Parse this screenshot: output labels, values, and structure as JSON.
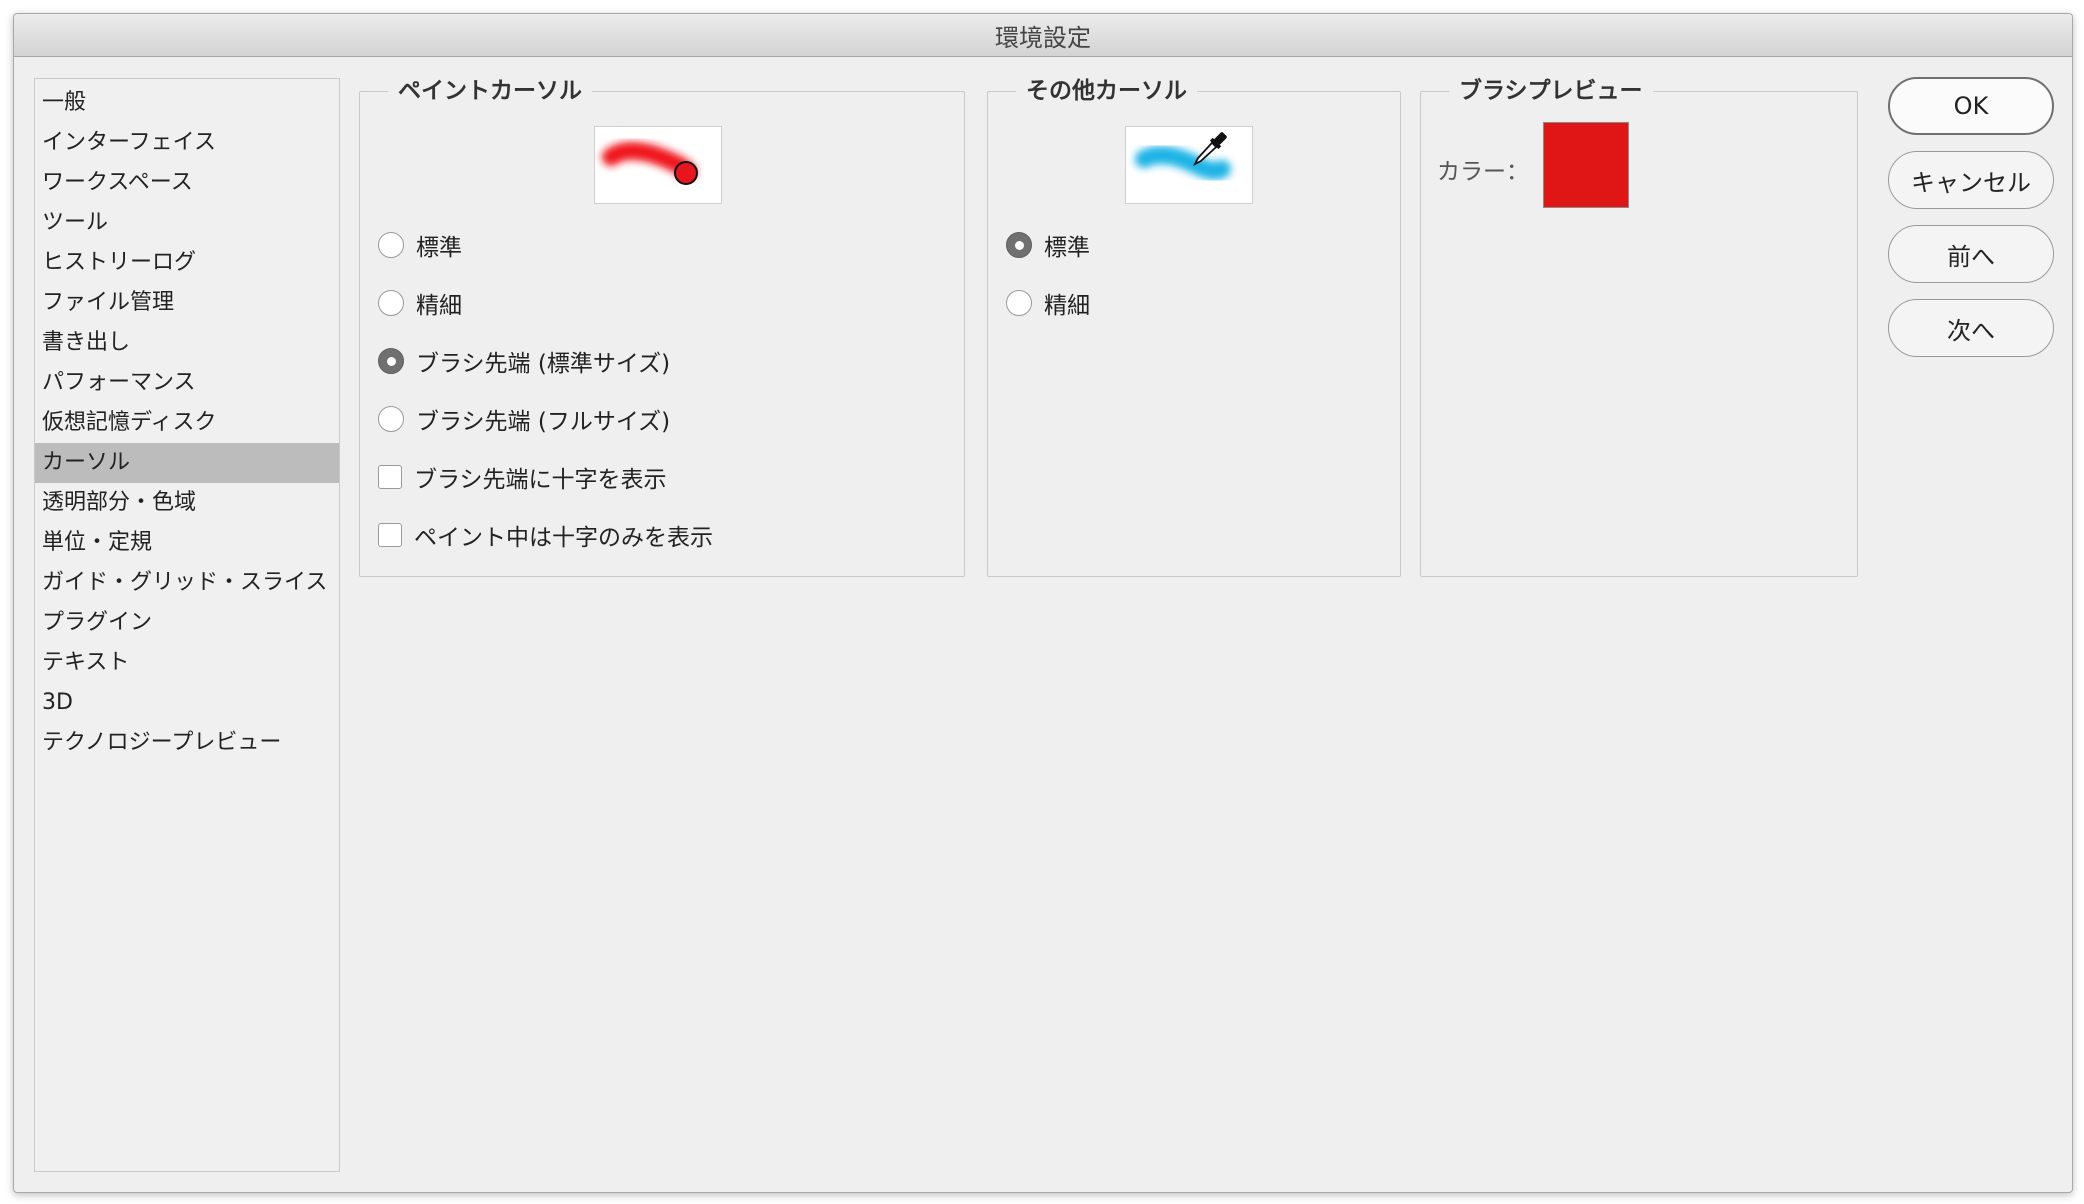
{
  "window": {
    "title": "環境設定"
  },
  "sidebar": {
    "items": [
      {
        "label": "一般",
        "name": "sidebar-item-general"
      },
      {
        "label": "インターフェイス",
        "name": "sidebar-item-interface"
      },
      {
        "label": "ワークスペース",
        "name": "sidebar-item-workspace"
      },
      {
        "label": "ツール",
        "name": "sidebar-item-tools"
      },
      {
        "label": "ヒストリーログ",
        "name": "sidebar-item-history-log"
      },
      {
        "label": "ファイル管理",
        "name": "sidebar-item-file-handling"
      },
      {
        "label": "書き出し",
        "name": "sidebar-item-export"
      },
      {
        "label": "パフォーマンス",
        "name": "sidebar-item-performance"
      },
      {
        "label": "仮想記憶ディスク",
        "name": "sidebar-item-scratch-disks"
      },
      {
        "label": "カーソル",
        "name": "sidebar-item-cursors"
      },
      {
        "label": "透明部分・色域",
        "name": "sidebar-item-transparency-gamut"
      },
      {
        "label": "単位・定規",
        "name": "sidebar-item-units-rulers"
      },
      {
        "label": "ガイド・グリッド・スライス",
        "name": "sidebar-item-guides-grid-slices"
      },
      {
        "label": "プラグイン",
        "name": "sidebar-item-plugins"
      },
      {
        "label": "テキスト",
        "name": "sidebar-item-type"
      },
      {
        "label": "3D",
        "name": "sidebar-item-3d"
      },
      {
        "label": "テクノロジープレビュー",
        "name": "sidebar-item-technology-previews"
      }
    ],
    "selected_label": "カーソル"
  },
  "paint_cursors": {
    "title": "ペイントカーソル",
    "preview_icon": "brush-stroke-red-circle-icon",
    "preview_color": "#f0141e",
    "options": [
      {
        "label": "標準",
        "checked": false
      },
      {
        "label": "精細",
        "checked": false
      },
      {
        "label": "ブラシ先端 (標準サイズ)",
        "checked": true
      },
      {
        "label": "ブラシ先端 (フルサイズ)",
        "checked": false
      }
    ],
    "checkboxes": [
      {
        "label": "ブラシ先端に十字を表示",
        "checked": false
      },
      {
        "label": "ペイント中は十字のみを表示",
        "checked": false
      }
    ]
  },
  "other_cursors": {
    "title": "その他カーソル",
    "preview_icon": "eyedropper-icon",
    "preview_color": "#1eb4e6",
    "options": [
      {
        "label": "標準",
        "checked": true
      },
      {
        "label": "精細",
        "checked": false
      }
    ]
  },
  "brush_preview": {
    "title": "ブラシプレビュー",
    "color_label": "カラー：",
    "color": "#e01616"
  },
  "buttons": {
    "ok": "OK",
    "cancel": "キャンセル",
    "prev": "前へ",
    "next": "次へ"
  }
}
